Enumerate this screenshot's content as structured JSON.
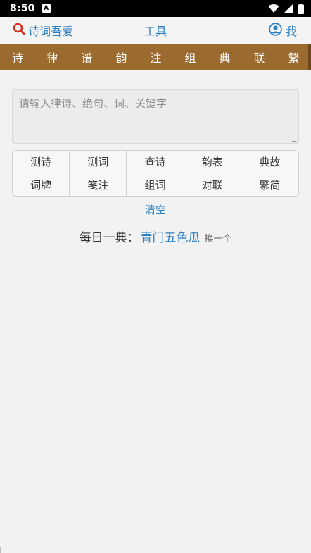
{
  "status": {
    "time": "8:50",
    "notification_icon": "A"
  },
  "header": {
    "search_label": "诗词吾爱",
    "title": "工具",
    "me_label": "我"
  },
  "categories": [
    "诗",
    "律",
    "谱",
    "韵",
    "注",
    "组",
    "典",
    "联",
    "繁"
  ],
  "input": {
    "placeholder": "请输入律诗、绝句、词、关键字",
    "value": ""
  },
  "tools": [
    "测诗",
    "测词",
    "查诗",
    "韵表",
    "典故",
    "词牌",
    "笺注",
    "组词",
    "对联",
    "繁简"
  ],
  "clear_label": "清空",
  "daily": {
    "label": "每日一典：",
    "title": "青门五色瓜",
    "swap_label": "换一个"
  },
  "colors": {
    "accent": "#2a7ec2",
    "category_bar": "#9a6a2e",
    "search_icon": "#d9281e"
  }
}
